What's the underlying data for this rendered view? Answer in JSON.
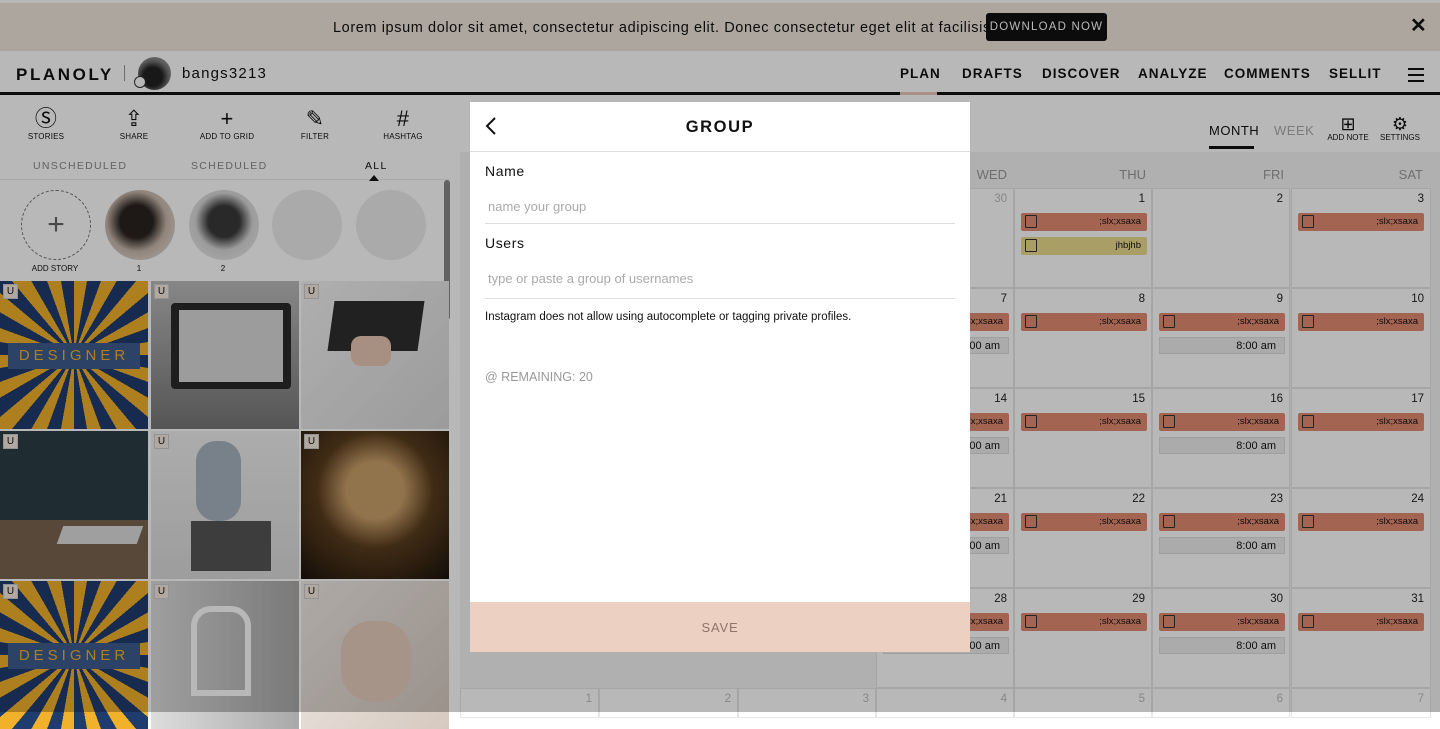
{
  "banner": {
    "text": "Lorem ipsum dolor sit amet, consectetur adipiscing elit. Donec consectetur eget elit at facilisis.",
    "button": "DOWNLOAD NOW",
    "close": "✕"
  },
  "header": {
    "logo": "PLANOLY",
    "username": "bangs3213",
    "nav": [
      "PLAN",
      "DRAFTS",
      "DISCOVER",
      "ANALYZE",
      "COMMENTS",
      "SELLIT"
    ]
  },
  "toolbar": {
    "items": [
      {
        "label": "STORIES",
        "icon": "stories-icon",
        "glyph": "Ⓢ"
      },
      {
        "label": "SHARE",
        "icon": "share-icon",
        "glyph": "⇪"
      },
      {
        "label": "ADD TO GRID",
        "icon": "plus-icon",
        "glyph": "+"
      },
      {
        "label": "FILTER",
        "icon": "magic-wand-icon",
        "glyph": "✎"
      },
      {
        "label": "HASHTAG",
        "icon": "hashtag-icon",
        "glyph": "#"
      }
    ]
  },
  "media_tabs": [
    "UNSCHEDULED",
    "SCHEDULED",
    "ALL"
  ],
  "stories": {
    "add_label": "ADD STORY",
    "items": [
      "1",
      "2"
    ]
  },
  "grid": {
    "badge": "U"
  },
  "calendar": {
    "views": [
      "MONTH",
      "WEEK"
    ],
    "actions": [
      "ADD NOTE",
      "SETTINGS"
    ],
    "day_names": [
      "WED",
      "THU",
      "FRI",
      "SAT"
    ],
    "pill_text": ";slx;xsaxa",
    "pill_text_2": "jhbjhb",
    "time": "8:00 am",
    "row1": {
      "wed": "30",
      "thu": "1",
      "fri": "2",
      "sat": "3"
    },
    "row2": {
      "wed": "7",
      "thu": "8",
      "fri": "9",
      "sat": "10"
    },
    "row3": {
      "wed": "14",
      "thu": "15",
      "fri": "16",
      "sat": "17"
    },
    "row4": {
      "wed": "21",
      "thu": "22",
      "fri": "23",
      "sat": "24"
    },
    "row5": {
      "wed": "28",
      "thu": "29",
      "fri": "30",
      "sat": "31"
    },
    "row6": [
      "1",
      "2",
      "3",
      "4",
      "5",
      "6",
      "7"
    ]
  },
  "modal": {
    "title": "GROUP",
    "name_label": "Name",
    "name_placeholder": "name your group",
    "users_label": "Users",
    "users_placeholder": "type or paste a group of usernames",
    "note": "Instagram does not allow using autocomplete or tagging private profiles.",
    "remaining": "@ REMAINING: 20",
    "save": "SAVE"
  },
  "colors": {
    "banner_bg": "#efe6dd",
    "pill": "#e38b72",
    "pill_yellow": "#ecdb8f",
    "save_bg": "#ecd1c2"
  }
}
